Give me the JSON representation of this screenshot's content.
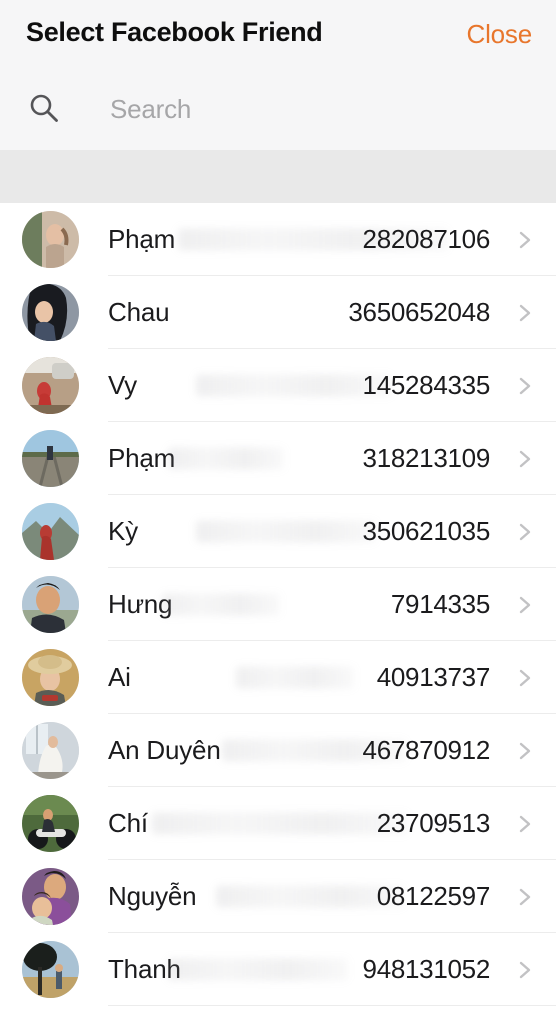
{
  "header": {
    "title": "Select Facebook Friend",
    "close_label": "Close",
    "accent_color": "#e8762c",
    "background_color": "#f6f6f7"
  },
  "search": {
    "icon": "search-icon",
    "value": "",
    "placeholder": "Search"
  },
  "band": {
    "background_color": "#e9e9e9"
  },
  "list": {
    "chevron_icon": "chevron-right-icon",
    "separator_color": "#ececec",
    "items": [
      {
        "name": "Phạm",
        "id": "282087106",
        "avatar": "avatar-photo-woman-plants",
        "redacted": true
      },
      {
        "name": "Chau",
        "id": "3650652048",
        "avatar": "avatar-photo-woman-darkhair",
        "redacted": false
      },
      {
        "name": "Vy",
        "id": "145284335",
        "avatar": "avatar-photo-woman-reddress",
        "redacted": true
      },
      {
        "name": "Phạm",
        "id": "318213109",
        "avatar": "avatar-photo-person-railway",
        "redacted": true
      },
      {
        "name": "Kỳ",
        "id": "350621035",
        "avatar": "avatar-photo-woman-mountains",
        "redacted": true
      },
      {
        "name": "Hưng",
        "id": "7914335",
        "avatar": "avatar-photo-man-smiling",
        "redacted": true
      },
      {
        "name": "Ai",
        "id": "40913737",
        "avatar": "avatar-photo-woman-hat",
        "redacted": true
      },
      {
        "name": "An Duyên",
        "id": "467870912",
        "avatar": "avatar-photo-bride-window",
        "redacted": true
      },
      {
        "name": "Chí",
        "id": "23709513",
        "avatar": "avatar-photo-man-scooter",
        "redacted": true
      },
      {
        "name": "Nguyễn",
        "id": "08122597",
        "avatar": "avatar-photo-man-child",
        "redacted": true
      },
      {
        "name": "Thanh",
        "id": "948131052",
        "avatar": "avatar-photo-person-tree",
        "redacted": true
      }
    ]
  }
}
